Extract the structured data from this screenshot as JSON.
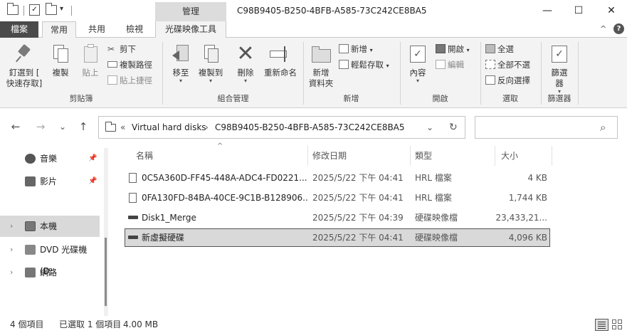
{
  "titlebar": {
    "manage_label": "管理",
    "title": "C98B9405-B250-4BFB-A585-73C242CE8BA5",
    "minimize_icon": "—",
    "maximize_icon": "☐",
    "close_icon": "✕"
  },
  "tabs": {
    "file": "檔案",
    "home": "常用",
    "share": "共用",
    "view": "檢視",
    "disk_tools": "光碟映像工具"
  },
  "ribbon": {
    "clipboard": {
      "label": "剪貼簿",
      "pin_line1": "釘選到 [",
      "pin_line2": "快速存取]",
      "copy": "複製",
      "paste": "貼上",
      "cut": "剪下",
      "copy_path": "複製路徑",
      "paste_shortcut": "貼上捷徑"
    },
    "organize": {
      "label": "組合管理",
      "move_to": "移至",
      "copy_to": "複製到",
      "delete": "刪除",
      "rename": "重新命名"
    },
    "new": {
      "label": "新增",
      "new_folder_line1": "新增",
      "new_folder_line2": "資料夾",
      "new_item": "新增",
      "easy_access": "輕鬆存取"
    },
    "open": {
      "label": "開啟",
      "properties": "內容",
      "open": "開啟",
      "edit": "編輯"
    },
    "select": {
      "label": "選取",
      "select_all": "全選",
      "select_none": "全部不選",
      "invert": "反向選擇"
    },
    "filter": {
      "label": "篩選器",
      "btn_line1": "篩選",
      "btn_line2": "器"
    }
  },
  "nav": {
    "back": "←",
    "forward": "→",
    "recent": "⌄",
    "up": "↑",
    "breadcrumb_chevron": "«",
    "breadcrumb_1": "Virtual hard disks",
    "breadcrumb_sep": "›",
    "breadcrumb_2": "C98B9405-B250-4BFB-A585-73C242CE8BA5",
    "dropdown": "⌄",
    "refresh": "↻",
    "search_placeholder": "",
    "search_icon": "⌕"
  },
  "sidebar": {
    "items": [
      {
        "label": "音樂",
        "icon": "music-icon",
        "pinned": true
      },
      {
        "label": "影片",
        "icon": "video-icon",
        "pinned": true
      },
      {
        "label": "本機",
        "icon": "computer-icon",
        "selected": true
      },
      {
        "label": "DVD 光碟機 (D:",
        "icon": "dvd-icon"
      },
      {
        "label": "網路",
        "icon": "network-icon"
      }
    ]
  },
  "columns": {
    "name": "名稱",
    "modified": "修改日期",
    "type": "類型",
    "size": "大小",
    "sort_indicator": "^"
  },
  "files": [
    {
      "name": "0C5A360D-FF45-448A-ADC4-FD0221...",
      "modified": "2025/5/22 下午 04:41",
      "type": "HRL 檔案",
      "size": "4 KB",
      "icon": "document-icon"
    },
    {
      "name": "0FA130FD-84BA-40CE-9C1B-B128906...",
      "modified": "2025/5/22 下午 04:41",
      "type": "HRL 檔案",
      "size": "1,744 KB",
      "icon": "document-icon"
    },
    {
      "name": "Disk1_Merge",
      "modified": "2025/5/22 下午 04:39",
      "type": "硬碟映像檔",
      "size": "23,433,21...",
      "icon": "disk-image-icon"
    },
    {
      "name": "新虛擬硬碟",
      "modified": "2025/5/22 下午 04:41",
      "type": "硬碟映像檔",
      "size": "4,096 KB",
      "icon": "disk-image-icon",
      "selected": true
    }
  ],
  "status": {
    "items": "4 個項目",
    "selected": "已選取 1 個項目",
    "size": "4.00 MB"
  },
  "help_icon": "?",
  "collapse_icon": "^"
}
